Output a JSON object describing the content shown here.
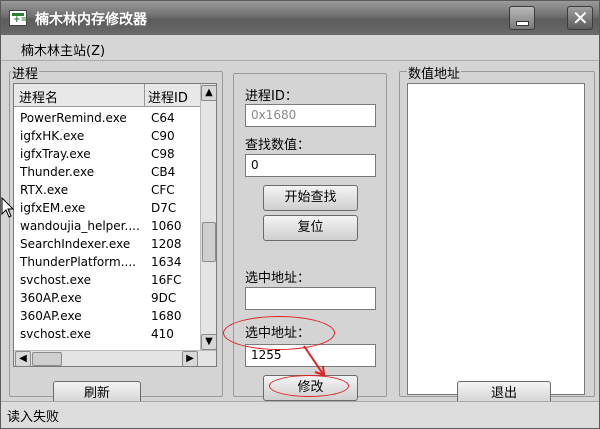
{
  "window": {
    "title": "楠木林内存修改器"
  },
  "menu": {
    "items": [
      {
        "label": "楠木林主站(Z)"
      }
    ]
  },
  "process_panel": {
    "label": "进程",
    "columns": [
      "进程名",
      "进程ID"
    ],
    "rows": [
      {
        "name": "PowerRemind.exe",
        "pid": "C64"
      },
      {
        "name": "igfxHK.exe",
        "pid": "C90"
      },
      {
        "name": "igfxTray.exe",
        "pid": "C98"
      },
      {
        "name": "Thunder.exe",
        "pid": "CB4"
      },
      {
        "name": "RTX.exe",
        "pid": "CFC"
      },
      {
        "name": "igfxEM.exe",
        "pid": "D7C"
      },
      {
        "name": "wandoujia_helper....",
        "pid": "1060"
      },
      {
        "name": "SearchIndexer.exe",
        "pid": "1208"
      },
      {
        "name": "ThunderPlatform....",
        "pid": "1634"
      },
      {
        "name": "svchost.exe",
        "pid": "16FC"
      },
      {
        "name": "360AP.exe",
        "pid": "9DC"
      },
      {
        "name": "360AP.exe",
        "pid": "1680"
      },
      {
        "name": "svchost.exe",
        "pid": "410"
      }
    ],
    "refresh_label": "刷新"
  },
  "search_panel": {
    "pid_label": "进程ID：",
    "pid_value": "0x1680",
    "search_value_label": "查找数值：",
    "search_value": "0",
    "start_search_label": "开始查找",
    "reset_label": "复位",
    "selected_address_label_1": "选中地址：",
    "selected_address_value_1": "",
    "selected_address_label_2": "选中地址：",
    "selected_address_value_2": "1255",
    "modify_label": "修改"
  },
  "address_panel": {
    "label": "数值地址",
    "exit_label": "退出"
  },
  "status": {
    "text": "读入失败"
  },
  "colors": {
    "annotation": "#e02020",
    "titlebar": "#6f6f6f"
  }
}
